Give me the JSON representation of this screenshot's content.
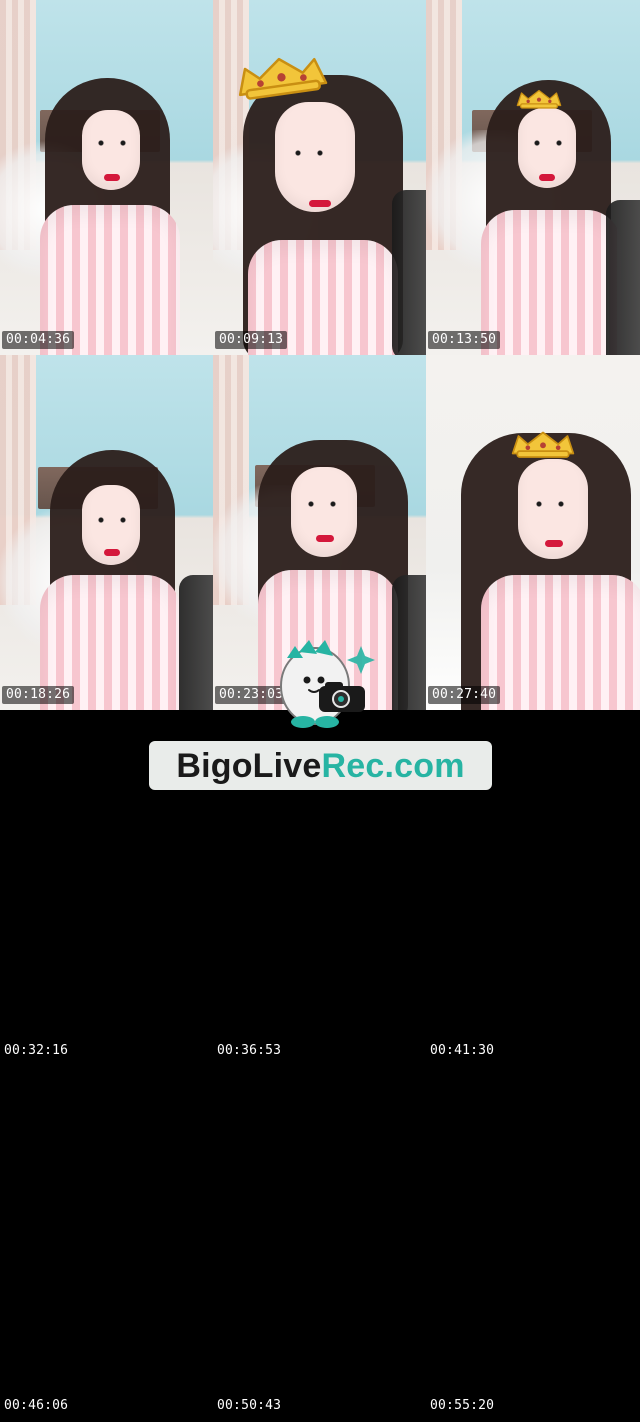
{
  "timestamps": [
    "00:04:36",
    "00:09:13",
    "00:13:50",
    "00:18:26",
    "00:23:03",
    "00:27:40",
    "00:32:16",
    "00:36:53",
    "00:41:30",
    "00:46:06",
    "00:50:43",
    "00:55:20"
  ],
  "brand": {
    "part1": "BigoLive",
    "part2": "Rec.com"
  },
  "colors": {
    "background": "#000000",
    "brand_accent": "#27b4a3",
    "brand_dark": "#1a1a1a",
    "brand_pill": "#e9ecea"
  },
  "icons": {
    "crown": "crown-icon",
    "mascot": "dinosaur-camera-mascot-icon",
    "sparkle": "sparkle-icon"
  }
}
